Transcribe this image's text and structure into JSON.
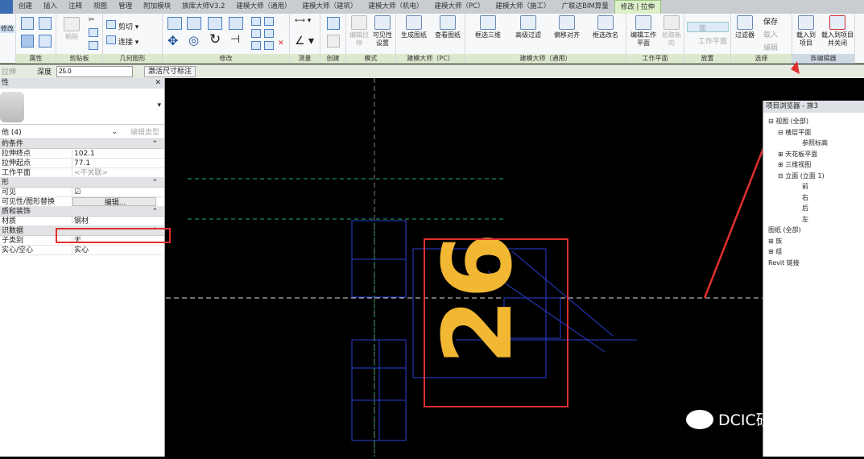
{
  "tabs": [
    "创建",
    "插入",
    "注释",
    "视图",
    "管理",
    "附加模块",
    "族库大师V3.2",
    "建模大师（通用）",
    "建模大师（建筑）",
    "建模大师（机电）",
    "建模大师（PC）",
    "建模大师（施工）",
    "广联达BIM算量",
    "修改 | 拉伸"
  ],
  "ribbon": {
    "panels": [
      "属性",
      "剪贴板",
      "几何图形",
      "修改",
      "测量",
      "创建",
      "模式",
      "建模大师（PC）",
      "建模大师（通用）",
      "工作平面",
      "放置",
      "选择",
      "族编辑器"
    ],
    "modify_label": "修改",
    "paste": "粘贴",
    "cut": "剪切",
    "join": "连接",
    "edit_extrusion": "编辑拉伸",
    "visibility_settings": "可见性设置",
    "generate_drawing": "生成图纸",
    "view_drawing": "查看图纸",
    "box_3d": "框选三维",
    "advanced_filter": "高级过滤",
    "offset_align": "偏移对齐",
    "box_rename": "框选改名",
    "edit_workplane": "编辑工作平面",
    "pick_new": "拾取新的",
    "face": "面",
    "workplane": "工作平面",
    "filter": "过滤器",
    "save": "保存",
    "load": "载入",
    "edit": "编辑",
    "load_to_project": "载入到项目",
    "load_to_project_close": "载入到项目并关闭"
  },
  "options": {
    "mode": "拉伸",
    "depth_label": "深度",
    "depth_value": "25.0",
    "activate_dim": "激活尺寸标注"
  },
  "properties": {
    "title": "性",
    "type_selector": "他 (4)",
    "edit_type": "编辑类型",
    "groups": [
      {
        "name": "約条件",
        "rows": [
          {
            "k": "拉伸终点",
            "v": "102.1"
          },
          {
            "k": "拉伸起点",
            "v": "77.1"
          },
          {
            "k": "工作平面",
            "v": "<不关联>"
          }
        ]
      },
      {
        "name": "形",
        "rows": [
          {
            "k": "可见",
            "v": "☑"
          },
          {
            "k": "可见性/图形替换",
            "v": "编辑..."
          }
        ]
      },
      {
        "name": "质和装饰",
        "rows": [
          {
            "k": "材质",
            "v": "钢材"
          }
        ]
      },
      {
        "name": "识数据",
        "rows": [
          {
            "k": "子类别",
            "v": "无"
          },
          {
            "k": "实心/空心",
            "v": "实心"
          }
        ]
      }
    ]
  },
  "browser": {
    "title": "项目浏览器 - 族3",
    "nodes": [
      "视图 (全部)",
      "楼层平面",
      "参照标高",
      "天花板平面",
      "三维视图",
      "立面 (立面 1)",
      "前",
      "右",
      "后",
      "左",
      "图纸 (全部)",
      "族",
      "组",
      "Revit 链接"
    ]
  },
  "canvas": {
    "number_text": "26"
  },
  "watermark": "DCIC研究所",
  "colors": {
    "highlight": "#e03030",
    "text_yellow": "#f2b733",
    "lines_blue": "#2a3fd0"
  }
}
